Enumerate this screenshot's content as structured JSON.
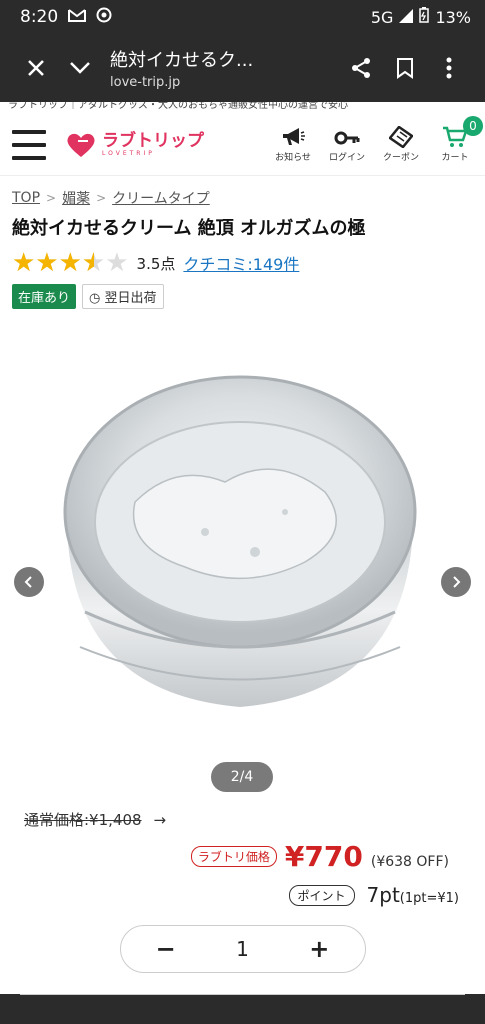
{
  "status": {
    "time": "8:20",
    "network": "5G",
    "battery": "13%"
  },
  "browser": {
    "title": "絶対イカせるク...",
    "url": "love-trip.jp"
  },
  "tagline": "ラブトリップ｜アダルトグッズ・大人のおもちゃ通販女性中心の運営で安心",
  "header": {
    "logo_text": "ラブトリップ",
    "logo_sub": "LOVETRIP",
    "icons": [
      {
        "label": "お知らせ",
        "icon": "megaphone-icon"
      },
      {
        "label": "ログイン",
        "icon": "key-icon"
      },
      {
        "label": "クーポン",
        "icon": "coupon-icon"
      },
      {
        "label": "カート",
        "icon": "cart-icon"
      }
    ],
    "cart_count": "0"
  },
  "breadcrumb": [
    "TOP",
    "媚薬",
    "クリームタイプ"
  ],
  "product": {
    "title": "絶対イカせるクリーム 絶頂 オルガズムの極",
    "rating": 3.5,
    "rating_text": "3.5点",
    "reviews_link": "クチコミ:149件",
    "stock": "在庫あり",
    "shipping": "翌日出荷"
  },
  "gallery": {
    "pager": "2/4"
  },
  "pricing": {
    "regular": "通常価格:¥1,408",
    "arrow": "→",
    "sale_tag": "ラブトリ価格",
    "sale_price": "¥770",
    "off": "(¥638 OFF)",
    "point_tag": "ポイント",
    "points": "7pt",
    "point_rate": "(1pt=¥1)"
  },
  "quantity": {
    "minus": "−",
    "value": "1",
    "plus": "+"
  },
  "colors": {
    "accent": "#e0335f",
    "price": "#d02222",
    "stock": "#1a8a4d",
    "link": "#1a76c2"
  }
}
